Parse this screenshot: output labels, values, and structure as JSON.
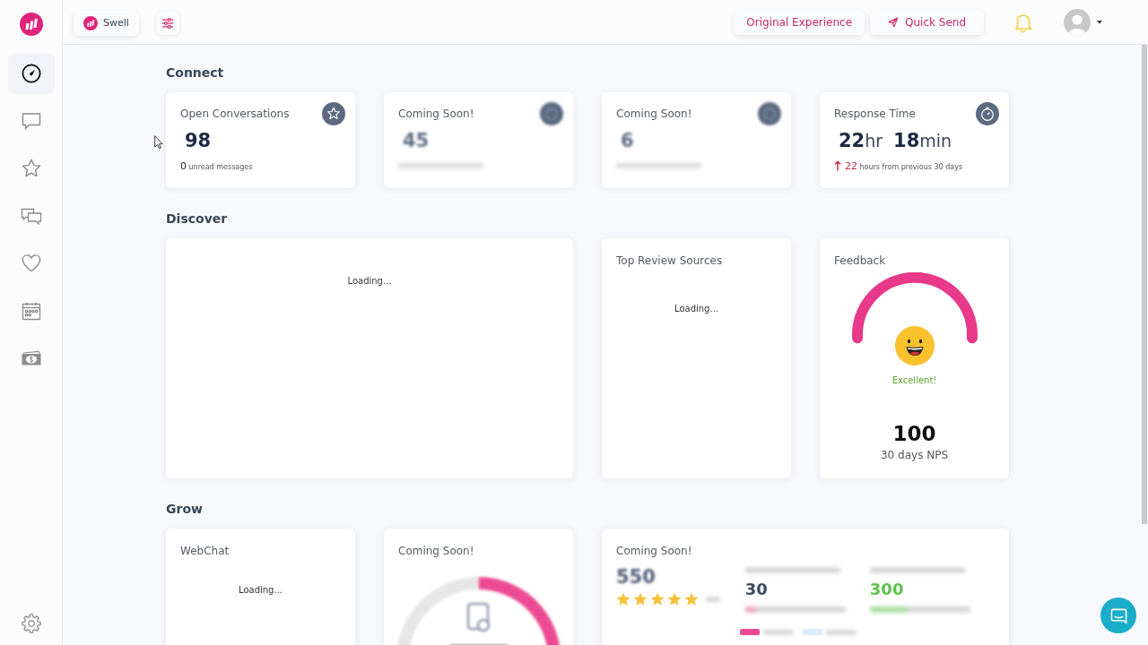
{
  "sidebar": {
    "items": [
      {
        "selected": true
      },
      {
        "selected": false
      },
      {
        "selected": false
      },
      {
        "selected": false
      },
      {
        "selected": false
      },
      {
        "selected": false
      },
      {
        "selected": false
      }
    ]
  },
  "top_bar": {
    "workspace": {
      "label": "Swell"
    },
    "buttons": [
      {
        "kind": "link",
        "label": "Original Experience"
      },
      {
        "kind": "send",
        "label": "Quick Send"
      }
    ]
  },
  "sections": [
    {
      "title": "Connect",
      "cards": [
        {
          "kind": "stat",
          "title": "Open Conversations",
          "values": [
            {
              "number": "98"
            }
          ],
          "caption": {
            "count": "0",
            "text": "unread messages"
          }
        },
        {
          "kind": "preview_stat",
          "title": "Coming Soon!",
          "values": [
            {
              "number": "45"
            }
          ]
        },
        {
          "kind": "preview_stat",
          "title": "Coming Soon!",
          "values": [
            {
              "number": "6"
            }
          ]
        },
        {
          "kind": "stat",
          "title": "Response Time",
          "values": [
            {
              "number": "22",
              "unit": "hr"
            },
            {
              "number": "18",
              "unit": "min"
            }
          ],
          "caption": {
            "rising": true,
            "count": "22",
            "text": "hours from previous 30 days"
          }
        }
      ]
    },
    {
      "title": "Discover",
      "cards": [
        {
          "kind": "panel_loading",
          "status": "Loading..."
        },
        {
          "kind": "loading",
          "title": "Top Review Sources",
          "status": "Loading..."
        },
        {
          "kind": "feedback",
          "title": "Feedback",
          "rating": "Excellent!",
          "score": "100",
          "caption": "30 days NPS"
        }
      ]
    },
    {
      "title": "Grow",
      "cards": [
        {
          "kind": "loading",
          "title": "WebChat",
          "status": "Loading..."
        },
        {
          "kind": "preview_donut",
          "title": "Coming Soon!"
        },
        {
          "kind": "preview_reviews",
          "title": "Coming Soon!",
          "total": "550",
          "stars": 5,
          "stats": [
            {
              "number": "30",
              "color": "#3e4a62",
              "rising": false
            },
            {
              "number": "300",
              "color": "#5cc24a",
              "rising": true
            }
          ]
        }
      ]
    }
  ]
}
